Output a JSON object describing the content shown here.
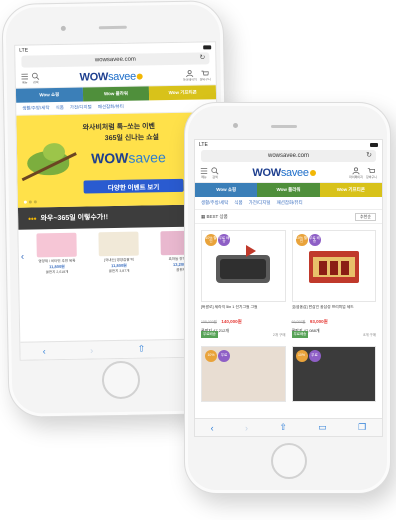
{
  "back_phone": {
    "status": {
      "carrier": "LTE"
    },
    "url": "wowsavee.com",
    "header_labels": [
      "메뉴",
      "검색",
      "마이페이지",
      "장바구니"
    ],
    "logo": {
      "wow": "WOW",
      "savee": "savee"
    },
    "tabs": [
      "Wow 쇼핑",
      "Wow 플라워",
      "Wow 기프티콘"
    ],
    "subcats": [
      "생활/주방/세탁",
      "식품",
      "가전/디지털",
      "패션잡화/뷰티"
    ],
    "banner": {
      "line1": "와사비처럼 톡~쏘는 이벤",
      "line2": "365일 신나는 쇼설",
      "logo_wow": "WOW",
      "logo_savee": "savee",
      "event_button": "다양한 이벤트 보기"
    },
    "promo": "와우~365일 이렇수가!!",
    "products": [
      {
        "title": "영양제 / 비타민 추천 목록",
        "price": "11,800원",
        "deal": "쿨판지 2,618개"
      },
      {
        "title": "[국내산] 영양찹쌀 떡",
        "price": "11,800원",
        "deal": "쿨판지 3,87개"
      },
      {
        "title": "흑마늘 진액 세트",
        "price": "13,200원",
        "deal": "쿨판지"
      }
    ],
    "colors": {
      "tab_blue": "#3b7fb8",
      "tab_green": "#4f8f3b",
      "tab_yellow": "#d8c21a",
      "banner": "#ffe14a"
    }
  },
  "front_phone": {
    "status": {
      "carrier": "LTE"
    },
    "url": "wowsavee.com",
    "header_labels": [
      "메뉴",
      "검색",
      "마이페이지",
      "장바구니"
    ],
    "logo": {
      "wow": "WOW",
      "savee": "savee"
    },
    "tabs": [
      "Wow 쇼핑",
      "Wow 플라워",
      "Wow 기프티콘"
    ],
    "subcats": [
      "생활/주방/세탁",
      "식품",
      "가전/디지털",
      "패션잡화/뷰티"
    ],
    "best": {
      "label": "BEST 상품",
      "sort": "추천순"
    },
    "cards": [
      {
        "badge1": "10%\n할인",
        "badge2": "무료\n배송",
        "title": "[버팔로] 세라믹 5in 1 전기그릴 그릴",
        "orig": "158,000원",
        "sale": "140,000원",
        "deal": "쿨판지 47,212개",
        "ship": "무료배송",
        "stock": "2개 구매"
      },
      {
        "badge1": "10%\n할인",
        "badge2": "무료\n배송",
        "title": "[농협홍삼] 한삼인 홍삼정 프리미엄 세트",
        "orig": "69,000원",
        "sale": "93,000원",
        "deal": "쿨판지 47,088개",
        "ship": "무료배송",
        "stock": "8개 구매"
      },
      {
        "badge1": "10%",
        "badge2": "무료"
      },
      {
        "badge1": "10%",
        "badge2": "무료"
      }
    ]
  }
}
